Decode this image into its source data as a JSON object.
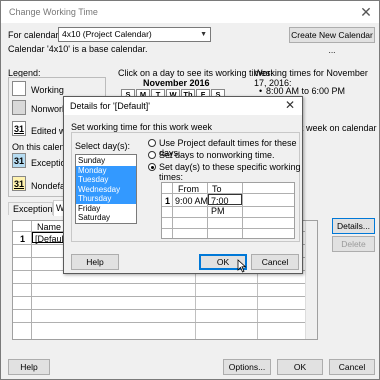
{
  "window": {
    "title": "Change Working Time",
    "close_glyph": "✕"
  },
  "calendar_row": {
    "for_label": "For calendar:",
    "selected": "4x10 (Project Calendar)",
    "create_button": "Create New Calendar ..."
  },
  "base_info": "Calendar '4x10' is a base calendar.",
  "legend": {
    "title": "Legend:",
    "working": "Working",
    "nonworking": "Nonworking",
    "edited": "Edited w",
    "edited_num": "31",
    "on_this_calendar": "On this calenda",
    "exception": "Exception c",
    "exception_num": "31",
    "nondefault": "Nondefault",
    "nondefault_num": "31"
  },
  "calendar": {
    "instruction": "Click on a day to see its working times:",
    "month": "November 2016",
    "days": [
      "S",
      "M",
      "T",
      "W",
      "Th",
      "F",
      "S"
    ]
  },
  "working_times": {
    "heading": "Working times for November 17, 2016:",
    "item1": "8:00 AM to 6:00 PM",
    "note": "k week on calendar"
  },
  "tabs": {
    "exceptions": "Exceptions",
    "work_weeks": "Wo"
  },
  "main_grid": {
    "col_name": "Name",
    "row1_num": "1",
    "row1_name": "[Default]"
  },
  "side_buttons": {
    "details": "Details...",
    "delete": "Delete"
  },
  "footer": {
    "help": "Help",
    "options": "Options...",
    "ok": "OK",
    "cancel": "Cancel"
  },
  "dialog": {
    "title": "Details for '[Default]'",
    "close_glyph": "✕",
    "section": "Set working time for this work week",
    "select_days_label": "Select day(s):",
    "days": [
      {
        "label": "Sunday",
        "selected": false
      },
      {
        "label": "Monday",
        "selected": true
      },
      {
        "label": "Tuesday",
        "selected": true
      },
      {
        "label": "Wednesday",
        "selected": true
      },
      {
        "label": "Thursday",
        "selected": true
      },
      {
        "label": "Friday",
        "selected": false
      },
      {
        "label": "Saturday",
        "selected": false
      }
    ],
    "radio_default": "Use Project default times for these days.",
    "radio_nonworking": "Set days to nonworking time.",
    "radio_specific": "Set day(s) to these specific working times:",
    "grid": {
      "col_from": "From",
      "col_to": "To",
      "row1_num": "1",
      "row1_from": "9:00 AM",
      "row1_to": "7:00 PM"
    },
    "help": "Help",
    "ok": "OK",
    "cancel": "Cancel"
  }
}
